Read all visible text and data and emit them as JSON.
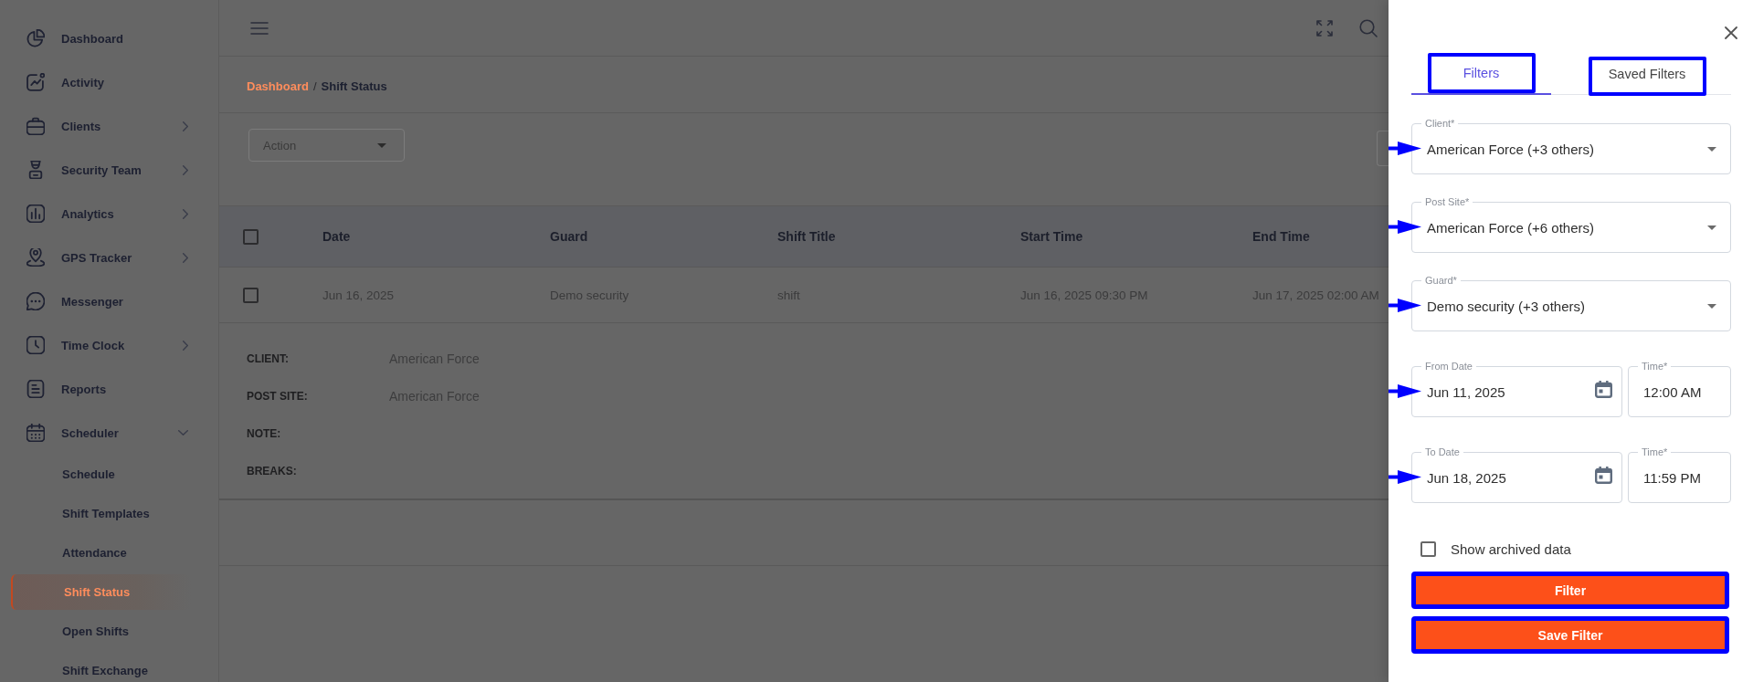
{
  "sidebar": {
    "items": [
      {
        "label": "Dashboard",
        "selected": false,
        "expandable": false
      },
      {
        "label": "Activity",
        "selected": false,
        "expandable": false
      },
      {
        "label": "Clients",
        "selected": false,
        "expandable": true,
        "expanded": false
      },
      {
        "label": "Security Team",
        "selected": false,
        "expandable": true,
        "expanded": false
      },
      {
        "label": "Analytics",
        "selected": false,
        "expandable": true,
        "expanded": false
      },
      {
        "label": "GPS Tracker",
        "selected": false,
        "expandable": true,
        "expanded": false
      },
      {
        "label": "Messenger",
        "selected": false,
        "expandable": false
      },
      {
        "label": "Time Clock",
        "selected": false,
        "expandable": true,
        "expanded": false
      },
      {
        "label": "Reports",
        "selected": false,
        "expandable": false
      },
      {
        "label": "Scheduler",
        "selected": false,
        "expandable": true,
        "expanded": true,
        "children": [
          {
            "label": "Schedule",
            "selected": false
          },
          {
            "label": "Shift Templates",
            "selected": false
          },
          {
            "label": "Attendance",
            "selected": false
          },
          {
            "label": "Shift Status",
            "selected": true
          },
          {
            "label": "Open Shifts",
            "selected": false
          },
          {
            "label": "Shift Exchange",
            "selected": false
          }
        ]
      }
    ]
  },
  "breadcrumb": {
    "separator": "/",
    "items": [
      {
        "label": "Dashboard",
        "current": false
      },
      {
        "label": "Shift Status",
        "current": true
      }
    ]
  },
  "toolbar": {
    "action_select": {
      "placeholder": "Action"
    }
  },
  "table": {
    "select_all_checked": false,
    "columns": [
      "Date",
      "Guard",
      "Shift Title",
      "Start Time",
      "End Time"
    ],
    "rows": [
      {
        "checked": false,
        "expanded": true,
        "cells": [
          "Jun 16, 2025",
          "Demo security",
          "shift",
          "Jun 16, 2025 09:30 PM",
          "Jun 17, 2025 02:00 AM"
        ],
        "details": [
          {
            "label": "CLIENT:",
            "value": "American Force"
          },
          {
            "label": "POST SITE:",
            "value": "American Force"
          },
          {
            "label": "NOTE:"
          },
          {
            "label": "BREAKS:"
          }
        ]
      }
    ]
  },
  "filter_panel": {
    "tabs": [
      {
        "label": "Filters",
        "selected": true,
        "highlighted": true
      },
      {
        "label": "Saved Filters",
        "selected": false,
        "highlighted": true
      }
    ],
    "fields": [
      {
        "kind": "select",
        "label": "Client*",
        "value": "American Force (+3 others)",
        "pointed": true
      },
      {
        "kind": "select",
        "label": "Post Site*",
        "value": "American Force (+6 others)",
        "pointed": true
      },
      {
        "kind": "select",
        "label": "Guard*",
        "value": "Demo security (+3 others)",
        "pointed": true
      },
      {
        "kind": "datetime",
        "label": "From Date",
        "value": "Jun 11, 2025",
        "time_label": "Time*",
        "time_value": "12:00 AM",
        "pointed": true
      },
      {
        "kind": "datetime",
        "label": "To Date",
        "value": "Jun 18, 2025",
        "time_label": "Time*",
        "time_value": "11:59 PM",
        "pointed": true
      }
    ],
    "archived": {
      "label": "Show archived data",
      "checked": false
    },
    "buttons": [
      {
        "label": "Filter",
        "highlighted": true
      },
      {
        "label": "Save Filter",
        "highlighted": true
      }
    ]
  }
}
